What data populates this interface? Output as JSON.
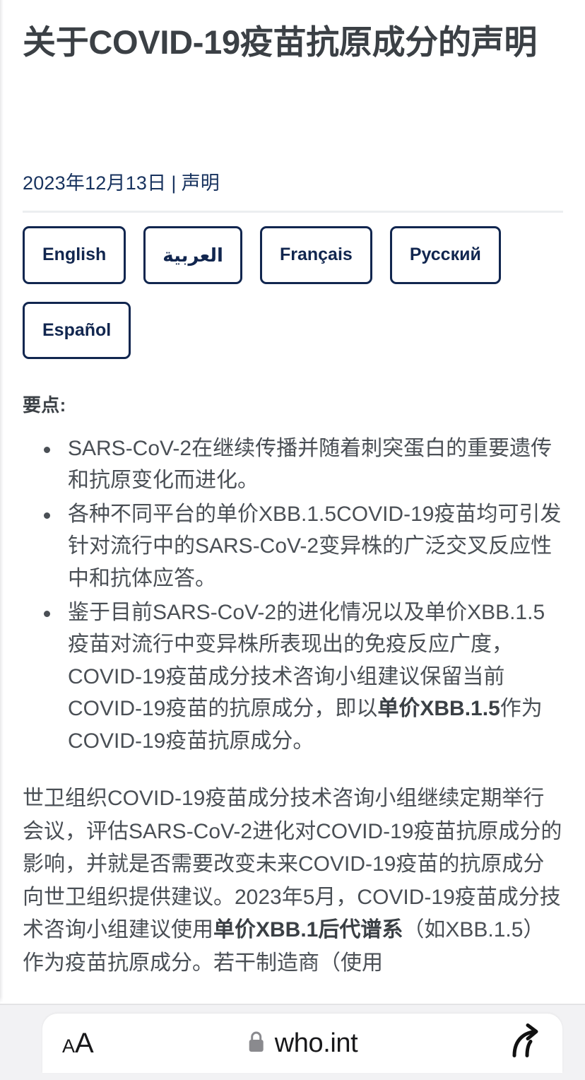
{
  "article": {
    "title": "关于COVID-19疫苗抗原成分的声明",
    "date": "2023年12月13日",
    "separator": "|",
    "doc_type": "声明",
    "languages": [
      {
        "label": "English"
      },
      {
        "label": "العربية"
      },
      {
        "label": "Français"
      },
      {
        "label": "Русский"
      },
      {
        "label": "Español"
      }
    ],
    "key_points_heading": "要点:",
    "key_points": [
      {
        "text_1": "SARS-CoV-2在继续传播并随着刺突蛋白的重要遗传和抗原变化而进化。"
      },
      {
        "text_1": "各种不同平台的单价XBB.1.5COVID-19疫苗均可引发针对流行中的SARS-CoV-2变异株的广泛交叉反应性中和抗体应答。"
      },
      {
        "text_1": "鉴于目前SARS-CoV-2的进化情况以及单价XBB.1.5疫苗对流行中变异株所表现出的免疫反应广度，COVID-19疫苗成分技术咨询小组建议保留当前COVID-19疫苗的抗原成分，即以",
        "bold": "单价XBB.1.5",
        "text_2": "作为COVID-19疫苗抗原成分。"
      }
    ],
    "body_paragraph": {
      "text_1": "世卫组织COVID-19疫苗成分技术咨询小组继续定期举行会议，评估SARS-CoV-2进化对COVID-19疫苗抗原成分的影响，并就是否需要改变未来COVID-19疫苗的抗原成分向世卫组织提供建议。2023年5月，COVID-19疫苗成分技术咨询小组建议使用",
      "bold": "单价XBB.1后代谱系",
      "text_2": "（如XBB.1.5）作为疫苗抗原成分。若干制造商（使用"
    }
  },
  "browser": {
    "text_size_small": "A",
    "text_size_large": "A",
    "lock_label": "lock-icon",
    "url": "who.int",
    "share_label": "share-icon",
    "watermark": ""
  }
}
